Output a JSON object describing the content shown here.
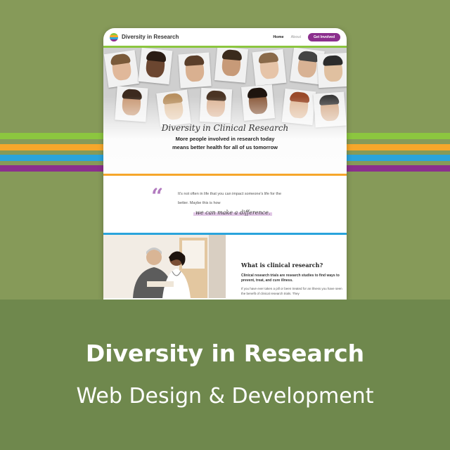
{
  "nav": {
    "brand": "Diversity in Research",
    "links": [
      "Home",
      "About"
    ],
    "cta": "Get Involved"
  },
  "hero": {
    "title": "Diversity in Clinical Research",
    "subtitle_line1": "More people involved in research today",
    "subtitle_line2": "means better health for all of us tomorrow"
  },
  "quote": {
    "mark": "“",
    "text": "It's not often in life that you can impact someone's life for the better. Maybe this is how",
    "highlight": "we can make a difference."
  },
  "info": {
    "heading": "What is clinical research?",
    "bold": "Clinical research trials are research studies to find ways to prevent, treat, and cure illness.",
    "body": "If you have ever taken a pill or been treated for an illness you have seen the benefit of clinical research trials. They"
  },
  "banner": {
    "title": "Diversity in Research",
    "subtitle": "Web Design & Development"
  },
  "colors": {
    "background": "#869a59",
    "banner": "#6f884d",
    "green": "#8cc63f",
    "orange": "#f6a72b",
    "blue": "#2aa4dc",
    "purple": "#8b2f8d"
  }
}
